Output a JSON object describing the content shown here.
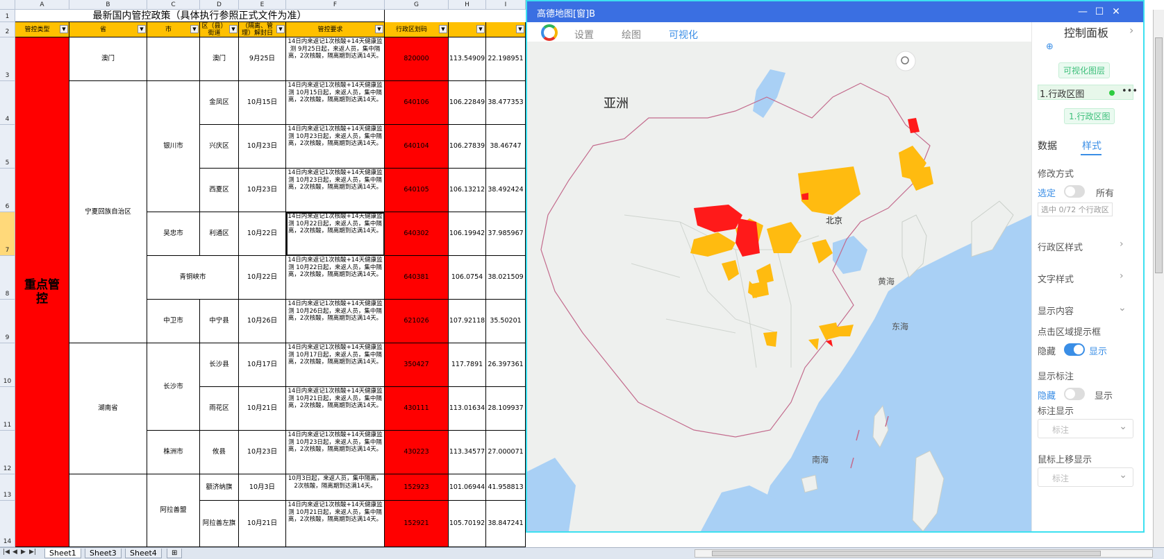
{
  "sheet": {
    "title": "最新国内管控政策（具体执行参照正式文件为准）",
    "column_letters": [
      "A",
      "B",
      "C",
      "D",
      "E",
      "F",
      "G",
      "H",
      "I"
    ],
    "row_numbers": [
      "1",
      "2",
      "3",
      "4",
      "5",
      "6",
      "7",
      "8",
      "9",
      "10",
      "11",
      "12",
      "13",
      "14"
    ],
    "headers": {
      "a": "管控类型",
      "b": "省",
      "c": "市",
      "d": "区（县）街道",
      "e": "（隔离、管理）解封日",
      "f": "管控要求",
      "g": "行政区划码",
      "h": "",
      "i": ""
    },
    "category": "重点管控",
    "provinces": {
      "aomen": "澳门",
      "ningxia": "宁夏回族自治区",
      "hunan": "湖南省"
    },
    "cities": {
      "yinchuan": "银川市",
      "wuzhong": "吴忠市",
      "qingtongxia": "青铜峡市",
      "zhongwei": "中卫市",
      "changsha": "长沙市",
      "zhuzhou": "株洲市",
      "alashan": "阿拉善盟"
    },
    "rows": [
      {
        "district": "澳门",
        "date": "9月25日",
        "req": "14日内来返记1次核酸+14天健康监测 9月25日起，来返人员，集中隔离，2次核酸，隔离期到达满14天。",
        "code": "820000",
        "lng": "113.54909",
        "lat": "22.198951"
      },
      {
        "district": "金凤区",
        "date": "10月15日",
        "req": "14日内来返记1次核酸+14天健康监测 10月15日起，来返人员，集中隔离，2次核酸，隔离期到达满14天。",
        "code": "640106",
        "lng": "106.22849",
        "lat": "38.477353"
      },
      {
        "district": "兴庆区",
        "date": "10月23日",
        "req": "14日内来返记1次核酸+14天健康监测 10月23日起，来返人员，集中隔离，2次核酸，隔离期到达满14天。",
        "code": "640104",
        "lng": "106.27839",
        "lat": "38.46747"
      },
      {
        "district": "西夏区",
        "date": "10月23日",
        "req": "14日内来返记1次核酸+14天健康监测 10月23日起，来返人员，集中隔离，2次核酸，隔离期到达满14天。",
        "code": "640105",
        "lng": "106.13212",
        "lat": "38.492424"
      },
      {
        "district": "利通区",
        "date": "10月22日",
        "req": "14日内来返记1次核酸+14天健康监测 10月22日起，来返人员，集中隔离，2次核酸，隔离期到达满14天。",
        "code": "640302",
        "lng": "106.19942",
        "lat": "37.985967"
      },
      {
        "district": "",
        "date": "10月22日",
        "req": "14日内来返记1次核酸+14天健康监测 10月22日起，来返人员，集中隔离，2次核酸，隔离期到达满14天。",
        "code": "640381",
        "lng": "106.0754",
        "lat": "38.021509"
      },
      {
        "district": "中宁县",
        "date": "10月26日",
        "req": "14日内来返记1次核酸+14天健康监测 10月26日起，来返人员，集中隔离，2次核酸，隔离期到达满14天。",
        "code": "621026",
        "lng": "107.92118",
        "lat": "35.50201"
      },
      {
        "district": "长沙县",
        "date": "10月17日",
        "req": "14日内来返记1次核酸+14天健康监测 10月17日起，来返人员，集中隔离，2次核酸，隔离期到达满14天。",
        "code": "350427",
        "lng": "117.7891",
        "lat": "26.397361"
      },
      {
        "district": "雨花区",
        "date": "10月21日",
        "req": "14日内来返记1次核酸+14天健康监测 10月21日起，来返人员，集中隔离，2次核酸，隔离期到达满14天。",
        "code": "430111",
        "lng": "113.01634",
        "lat": "28.109937"
      },
      {
        "district": "攸县",
        "date": "10月23日",
        "req": "14日内来返记1次核酸+14天健康监测 10月23日起，来返人员，集中隔离，2次核酸，隔离期到达满14天。",
        "code": "430223",
        "lng": "113.34577",
        "lat": "27.000071"
      },
      {
        "district": "额济纳旗",
        "date": "10月3日",
        "req": "10月3日起，来返人员，集中隔离，2次核酸，隔离期到达满14天。",
        "code": "152923",
        "lng": "101.06944",
        "lat": "41.958813"
      },
      {
        "district": "阿拉善左旗",
        "date": "10月21日",
        "req": "14日内来返记1次核酸+14天健康监测 10月21日起，来返人员，集中隔离，2次核酸，隔离期到达满14天。",
        "code": "152921",
        "lng": "105.70192",
        "lat": "38.847241"
      }
    ],
    "tabs": [
      "Sheet1",
      "Sheet3",
      "Sheet4"
    ]
  },
  "map_window": {
    "title": "高德地图[窗]B",
    "menu": [
      "设置",
      "绘图",
      "可视化"
    ],
    "labels": {
      "asia": "亚洲",
      "beijing": "北京",
      "yellow_sea": "黄海",
      "east_sea": "东海",
      "south_sea": "南海"
    },
    "panel": {
      "title": "控制面板",
      "layer_group": "可视化图层",
      "layer_item": "1.行政区图",
      "layer_tag": "1.行政区图",
      "tab_data": "数据",
      "tab_style": "样式",
      "modify_mode": "修改方式",
      "selected": "选定",
      "all": "所有",
      "selected_count": "选中 0/72 个行政区",
      "region_style": "行政区样式",
      "text_style": "文字样式",
      "show_content": "显示内容",
      "click_tooltip": "点击区域提示框",
      "hide": "隐藏",
      "show": "显示",
      "show_label": "显示标注",
      "label_display": "标注显示",
      "label_placeholder": "标注",
      "hover_display": "鼠标上移显示",
      "hover_placeholder": "标注"
    },
    "colors": {
      "highlight_red": "#ff1a1a",
      "highlight_yellow": "#ffbb10",
      "water": "#a9d0f5",
      "land": "#eef0ee",
      "accent": "#3a8ee6"
    }
  }
}
